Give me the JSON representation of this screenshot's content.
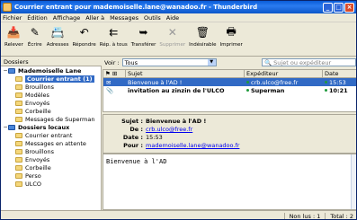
{
  "window": {
    "title": "Courrier entrant pour mademoiselle.lane@wanadoo.fr - Thunderbird"
  },
  "menu": [
    "Fichier",
    "Édition",
    "Affichage",
    "Aller à",
    "Messages",
    "Outils",
    "Aide"
  ],
  "toolbar": [
    {
      "label": "Relever",
      "icon": "download-icon",
      "glyph": "📥",
      "disabled": false
    },
    {
      "label": "Écrire",
      "icon": "write-icon",
      "glyph": "✎",
      "disabled": false
    },
    {
      "label": "Adresses",
      "icon": "address-book-icon",
      "glyph": "📇",
      "disabled": false
    },
    {
      "label": "Répondre",
      "icon": "reply-icon",
      "glyph": "↶",
      "disabled": false
    },
    {
      "label": "Rép. à tous",
      "icon": "reply-all-icon",
      "glyph": "⇇",
      "disabled": false
    },
    {
      "label": "Transférer",
      "icon": "forward-icon",
      "glyph": "➥",
      "disabled": false
    },
    {
      "label": "Supprimer",
      "icon": "delete-icon",
      "glyph": "✕",
      "disabled": true
    },
    {
      "label": "Indésirable",
      "icon": "junk-icon",
      "glyph": "🗑",
      "disabled": false
    },
    {
      "label": "Imprimer",
      "icon": "print-icon",
      "glyph": "🖶",
      "disabled": false
    }
  ],
  "folders_label": "Dossiers",
  "folders": [
    {
      "label": "Mademoiselle Lane",
      "level": 0,
      "twisty": "−",
      "bold": true,
      "selected": false,
      "account": true,
      "name": "folder-account-mademoiselle-lane"
    },
    {
      "label": "Courrier entrant (1)",
      "level": 1,
      "twisty": "",
      "bold": true,
      "selected": true,
      "account": false,
      "name": "folder-inbox"
    },
    {
      "label": "Brouillons",
      "level": 1,
      "twisty": "",
      "bold": false,
      "selected": false,
      "account": false,
      "name": "folder-drafts"
    },
    {
      "label": "Modèles",
      "level": 1,
      "twisty": "",
      "bold": false,
      "selected": false,
      "account": false,
      "name": "folder-templates"
    },
    {
      "label": "Envoyés",
      "level": 1,
      "twisty": "",
      "bold": false,
      "selected": false,
      "account": false,
      "name": "folder-sent"
    },
    {
      "label": "Corbeille",
      "level": 1,
      "twisty": "",
      "bold": false,
      "selected": false,
      "account": false,
      "name": "folder-trash"
    },
    {
      "label": "Messages de Superman",
      "level": 1,
      "twisty": "",
      "bold": false,
      "selected": false,
      "account": false,
      "name": "folder-superman"
    },
    {
      "label": "Dossiers locaux",
      "level": 0,
      "twisty": "−",
      "bold": true,
      "selected": false,
      "account": true,
      "name": "folder-account-local"
    },
    {
      "label": "Courrier entrant",
      "level": 1,
      "twisty": "",
      "bold": false,
      "selected": false,
      "account": false,
      "name": "folder-local-inbox"
    },
    {
      "label": "Messages en attente",
      "level": 1,
      "twisty": "",
      "bold": false,
      "selected": false,
      "account": false,
      "name": "folder-outbox"
    },
    {
      "label": "Brouillons",
      "level": 1,
      "twisty": "",
      "bold": false,
      "selected": false,
      "account": false,
      "name": "folder-local-drafts"
    },
    {
      "label": "Envoyés",
      "level": 1,
      "twisty": "",
      "bold": false,
      "selected": false,
      "account": false,
      "name": "folder-local-sent"
    },
    {
      "label": "Corbeille",
      "level": 1,
      "twisty": "",
      "bold": false,
      "selected": false,
      "account": false,
      "name": "folder-local-trash"
    },
    {
      "label": "Perso",
      "level": 1,
      "twisty": "",
      "bold": false,
      "selected": false,
      "account": false,
      "name": "folder-perso"
    },
    {
      "label": "ULCO",
      "level": 1,
      "twisty": "",
      "bold": false,
      "selected": false,
      "account": false,
      "name": "folder-ulco"
    }
  ],
  "viewbar": {
    "label": "Voir :",
    "value": "Tous",
    "search_placeholder": "Sujet ou expéditeur"
  },
  "thread": {
    "headers": {
      "subject": "Sujet",
      "from": "Expéditeur",
      "date": "Date"
    },
    "rows": [
      {
        "subject": "Bienvenue à l'AD !",
        "from": "crb.ulco@free.fr",
        "date": "15:53",
        "selected": true,
        "bold": false,
        "attach": false
      },
      {
        "subject": "invitation au zinzin de l'ULCO",
        "from": "Superman",
        "date": "10:21",
        "selected": false,
        "bold": true,
        "attach": true
      }
    ]
  },
  "message": {
    "labels": {
      "subject": "Sujet :",
      "from": "De :",
      "date": "Date :",
      "to": "Pour :"
    },
    "subject": "Bienvenue à l'AD !",
    "from": "crb.ulco@free.fr",
    "date": "15:53",
    "to": "mademoiselle.lane@wanadoo.fr",
    "body": "Bienvenue à l'AD"
  },
  "status": {
    "unread": "Non lus : 1",
    "total": "Total : 2"
  }
}
